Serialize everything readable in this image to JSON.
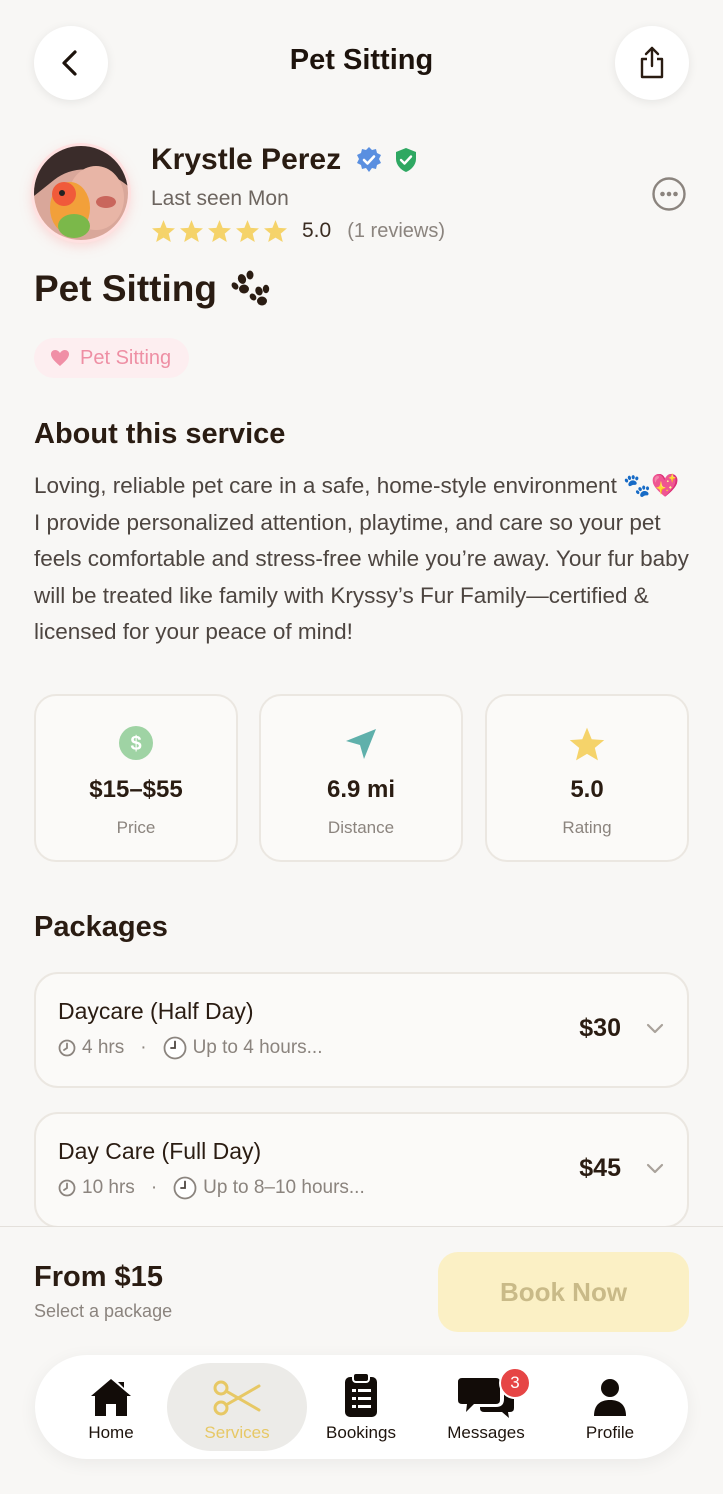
{
  "header": {
    "title": "Pet Sitting"
  },
  "provider": {
    "name": "Krystle Perez",
    "last_seen": "Last seen Mon",
    "rating": "5.0",
    "reviews": "(1 reviews)"
  },
  "service": {
    "title": "Pet Sitting",
    "category": "Pet Sitting",
    "about_heading": "About this service",
    "about_text": "Loving, reliable pet care in a safe, home-style environment 🐾💖 I provide personalized attention, playtime, and care so your pet feels comfortable and stress-free while you’re away. Your fur baby will be treated like family with Kryssy’s Fur Family—certified & licensed for your peace of mind!"
  },
  "stats": {
    "price": {
      "value": "$15–$55",
      "label": "Price"
    },
    "distance": {
      "value": "6.9 mi",
      "label": "Distance"
    },
    "rating": {
      "value": "5.0",
      "label": "Rating"
    }
  },
  "packages": {
    "heading": "Packages",
    "items": [
      {
        "name": "Daycare (Half Day)",
        "duration": "4 hrs",
        "description": "Up to 4 hours...",
        "price": "$30"
      },
      {
        "name": "Day Care (Full Day)",
        "duration": "10 hrs",
        "description": "Up to 8–10 hours...",
        "price": "$45"
      }
    ]
  },
  "booking": {
    "from_price": "From $15",
    "hint": "Select a package",
    "book_label": "Book Now"
  },
  "nav": {
    "home": "Home",
    "services": "Services",
    "bookings": "Bookings",
    "messages": "Messages",
    "messages_badge": "3",
    "profile": "Profile"
  },
  "colors": {
    "accent_yellow": "#e7c865",
    "star": "#f5d36a",
    "verified_blue": "#5a8fe0",
    "verified_green": "#2fa862",
    "tag_pink": "#ee8fa4",
    "badge_red": "#e64545"
  }
}
